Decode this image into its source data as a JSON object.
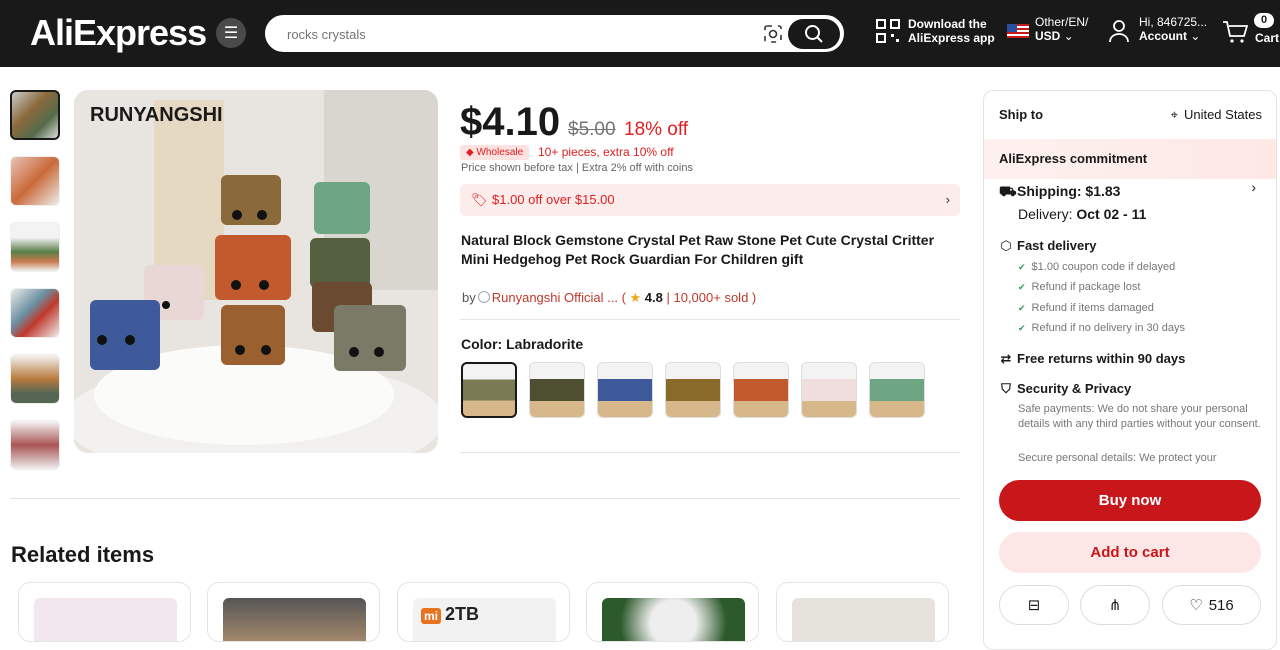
{
  "header": {
    "logo": "AliExpress",
    "search_placeholder": "rocks crystals",
    "download_line1": "Download the",
    "download_line2": "AliExpress app",
    "locale_line1": "Other/EN/",
    "locale_line2": "USD",
    "account_line1": "Hi, 846725...",
    "account_line2": "Account",
    "cart_count": "0",
    "cart_label": "Cart"
  },
  "gallery": {
    "brand_overlay": "RUNYANGSHI",
    "thumb_count": 6
  },
  "product": {
    "price": "$4.10",
    "old_price": "$5.00",
    "discount": "18% off",
    "wholesale_badge": "Wholesale",
    "wholesale_text": "10+ pieces, extra 10% off",
    "tax_note": "Price shown before tax",
    "coins_note": "Extra 2% off with coins",
    "coupon": "$1.00 off over $15.00",
    "title": "Natural Block Gemstone Crystal Pet Raw Stone Pet Cute Crystal Critter Mini Hedgehog Pet Rock Guardian For Children gift",
    "store_prefix": "by",
    "store_name": "Runyangshi Official ...",
    "rating": "4.8",
    "sold": "10,000+ sold",
    "color_label": "Color: Labradorite"
  },
  "related": {
    "heading": "Related items",
    "card3_label": "2TB"
  },
  "panel": {
    "ship_to_label": "Ship to",
    "ship_country": "United States",
    "commitment": "AliExpress commitment",
    "shipping": "Shipping: $1.83",
    "delivery_label": "Delivery:",
    "delivery_date": "Oct 02 - 11",
    "fast_delivery": "Fast delivery",
    "fd_items": [
      "$1.00 coupon code if delayed",
      "Refund if package lost",
      "Refund if items damaged",
      "Refund if no delivery in 30 days"
    ],
    "free_returns": "Free returns within 90 days",
    "security": "Security & Privacy",
    "security_text": "Safe payments: We do not share your personal details with any third parties without your consent.",
    "security_text2": "Secure personal details: We protect your",
    "buy_now": "Buy now",
    "add_to_cart": "Add to cart",
    "wishlist_count": "516"
  },
  "colors": {
    "accent": "#c8171b",
    "topbar": "#191919"
  }
}
